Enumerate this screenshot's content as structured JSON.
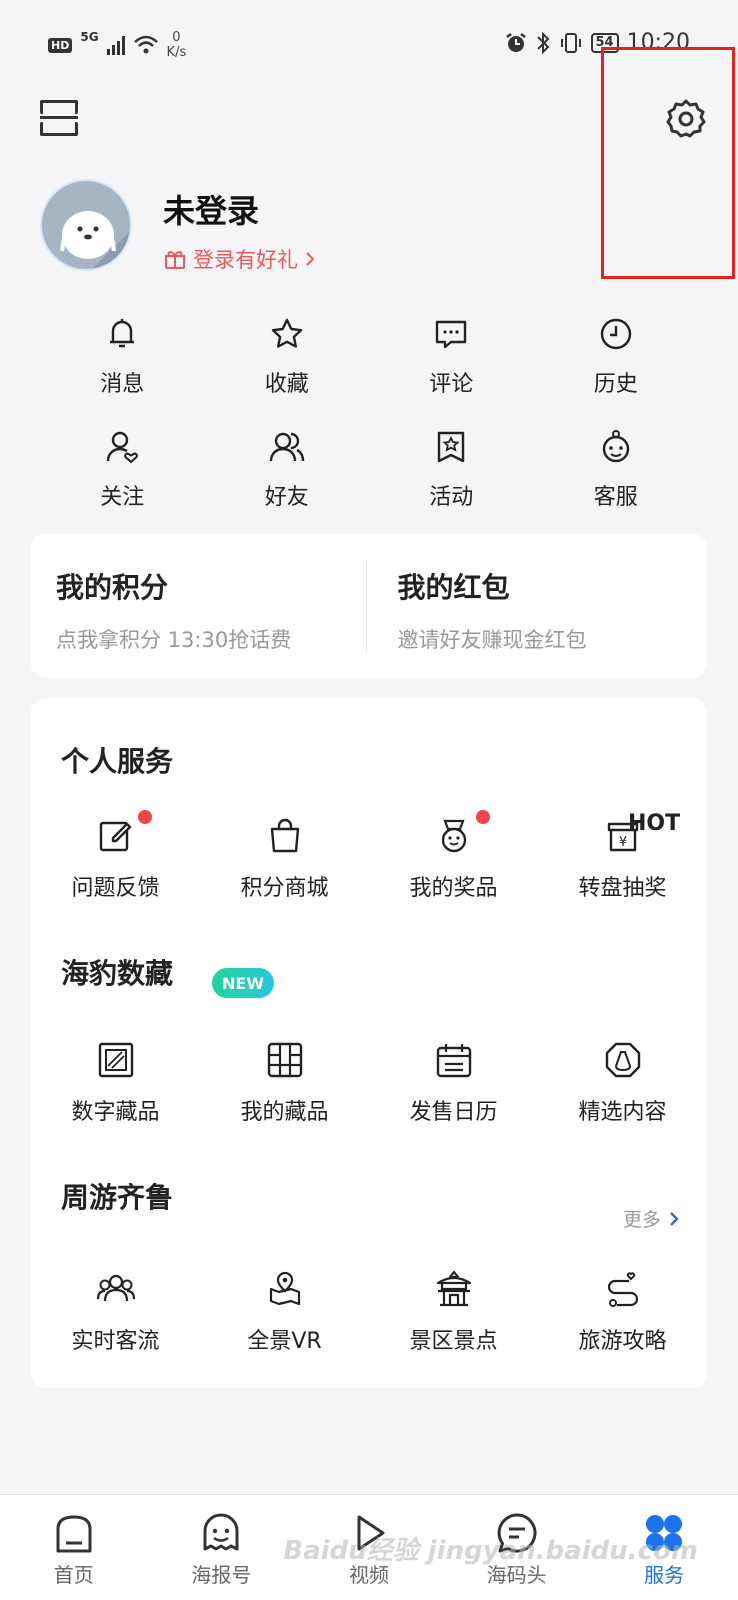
{
  "status_bar": {
    "hd": "HD",
    "network": "5G",
    "speed_value": "0",
    "speed_unit": "K/s",
    "battery": "54",
    "time": "10:20"
  },
  "profile": {
    "name": "未登录",
    "gift_text": "登录有好礼"
  },
  "quick_actions": [
    {
      "label": "消息",
      "icon": "bell-icon"
    },
    {
      "label": "收藏",
      "icon": "star-icon"
    },
    {
      "label": "评论",
      "icon": "comment-icon"
    },
    {
      "label": "历史",
      "icon": "clock-icon"
    },
    {
      "label": "关注",
      "icon": "follow-icon"
    },
    {
      "label": "好友",
      "icon": "friends-icon"
    },
    {
      "label": "活动",
      "icon": "activity-icon"
    },
    {
      "label": "客服",
      "icon": "service-icon"
    }
  ],
  "points_card": {
    "points_title": "我的积分",
    "points_sub": "点我拿积分 13:30抢话费",
    "redpack_title": "我的红包",
    "redpack_sub": "邀请好友赚现金红包"
  },
  "personal_service": {
    "title": "个人服务",
    "items": [
      {
        "label": "问题反馈",
        "icon": "feedback-icon",
        "dot": true
      },
      {
        "label": "积分商城",
        "icon": "bag-icon"
      },
      {
        "label": "我的奖品",
        "icon": "prize-icon",
        "dot": true
      },
      {
        "label": "转盘抽奖",
        "icon": "lottery-icon",
        "badge": "HOT"
      }
    ]
  },
  "digital_collection": {
    "title": "海豹数藏",
    "badge": "NEW",
    "items": [
      {
        "label": "数字藏品",
        "icon": "digital-item-icon"
      },
      {
        "label": "我的藏品",
        "icon": "grid-icon"
      },
      {
        "label": "发售日历",
        "icon": "calendar-icon"
      },
      {
        "label": "精选内容",
        "icon": "selected-icon"
      }
    ]
  },
  "travel": {
    "title": "周游齐鲁",
    "more": "更多",
    "items": [
      {
        "label": "实时客流",
        "icon": "crowd-icon"
      },
      {
        "label": "全景VR",
        "icon": "vr-icon"
      },
      {
        "label": "景区景点",
        "icon": "pavilion-icon"
      },
      {
        "label": "旅游攻略",
        "icon": "route-icon"
      }
    ]
  },
  "tabbar": [
    {
      "label": "首页",
      "icon": "home-icon"
    },
    {
      "label": "海报号",
      "icon": "poster-icon"
    },
    {
      "label": "视频",
      "icon": "video-icon"
    },
    {
      "label": "海码头",
      "icon": "chat-icon"
    },
    {
      "label": "服务",
      "icon": "service-grid-icon",
      "active": true
    }
  ],
  "colors": {
    "accent": "#1a73e8",
    "red": "#f0434c",
    "highlight_box": "#e2231a"
  },
  "watermark": "Baidu经验 jingyan.baidu.com"
}
